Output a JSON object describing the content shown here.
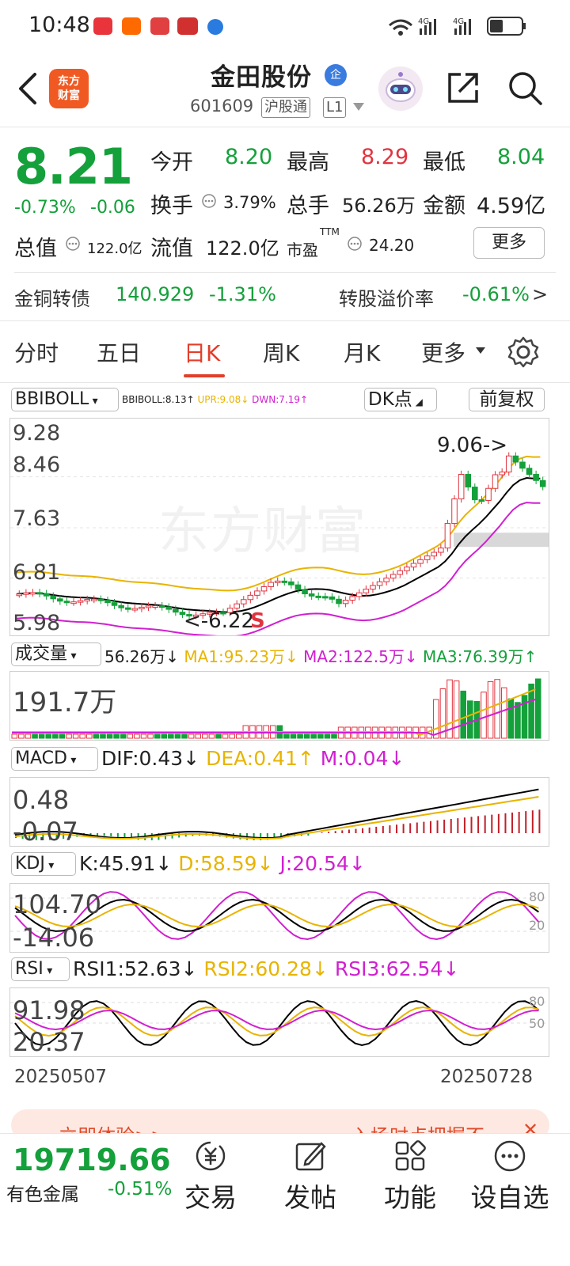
{
  "status_bar": {
    "time": "10:48",
    "net1": "4G",
    "net2": "4G"
  },
  "header": {
    "name": "金田股份",
    "badge": "企",
    "code": "601609",
    "tag1": "沪股通",
    "tag2": "L1",
    "logo": "东方\n财富"
  },
  "quote": {
    "price": "8.21",
    "change_pct": "-0.73%",
    "change": "-0.06",
    "open_label": "今开",
    "open": "8.20",
    "high_label": "最高",
    "high": "8.29",
    "low_label": "最低",
    "low": "8.04",
    "turnover_label": "换手",
    "turnover": "3.79%",
    "volume_label": "总手",
    "volume": "56.26万",
    "amount_label": "金额",
    "amount": "4.59亿",
    "mktcap_label": "总值",
    "mktcap": "122.0亿",
    "float_label": "流值",
    "float": "122.0亿",
    "pe_label": "市盈",
    "pe_sup": "TTM",
    "pe": "24.20",
    "more": "更多"
  },
  "bond": {
    "name": "金铜转债",
    "price": "140.929",
    "pct": "-1.31%",
    "premium_label": "转股溢价率",
    "premium": "-0.61%",
    "arrow": ">"
  },
  "tabs": [
    "分时",
    "五日",
    "日K",
    "周K",
    "月K",
    "更多"
  ],
  "active_tab": "日K",
  "main_indicator": {
    "name": "BBIBOLL",
    "values": "BBIBOLL:8.13↑",
    "upr": "UPR:9.08↓",
    "dwn": "DWN:7.19↑",
    "dk_label": "DK点",
    "adjust_label": "前复权",
    "y_labels": [
      "9.28",
      "8.46",
      "7.63",
      "6.81",
      "5.98"
    ],
    "high_mark": "9.06->",
    "low_mark": "<-6.22",
    "s_mark": "S",
    "watermark": "东方财富"
  },
  "volume": {
    "name": "成交量",
    "current": "56.26万↓",
    "ma1": "MA1:95.23万↓",
    "ma2": "MA2:122.5万↓",
    "ma3": "MA3:76.39万↑",
    "y_label": "191.7万"
  },
  "macd": {
    "name": "MACD",
    "dif": "DIF:0.43↓",
    "dea": "DEA:0.41↑",
    "m": "M:0.04↓",
    "y_top": "0.48",
    "y_bottom": "-0.07"
  },
  "kdj": {
    "name": "KDJ",
    "k": "K:45.91↓",
    "d": "D:58.59↓",
    "j": "J:20.54↓",
    "y_top": "104.70",
    "y_bottom": "-14.06",
    "ref_hi": "80",
    "ref_lo": "20"
  },
  "rsi": {
    "name": "RSI",
    "rsi1": "RSI1:52.63↓",
    "rsi2": "RSI2:60.28↓",
    "rsi3": "RSI3:62.54↓",
    "y_top": "91.98",
    "y_bottom": "20.37",
    "ref_hi": "80",
    "ref_lo": "50"
  },
  "date_range": {
    "start": "20250507",
    "end": "20250728"
  },
  "promo": {
    "left": "立即体验>>",
    "right": "入场时点把握不"
  },
  "bottom": {
    "index_value": "19719.66",
    "index_name": "有色金属",
    "index_change": "-0.51%",
    "nav": [
      "交易",
      "发帖",
      "功能",
      "设自选"
    ]
  },
  "colors": {
    "up": "#e0343f",
    "down": "#14a03a",
    "accent": "#e23e2a",
    "boll_mid": "#000000",
    "boll_up": "#e8b400",
    "boll_dn": "#d020d0"
  }
}
